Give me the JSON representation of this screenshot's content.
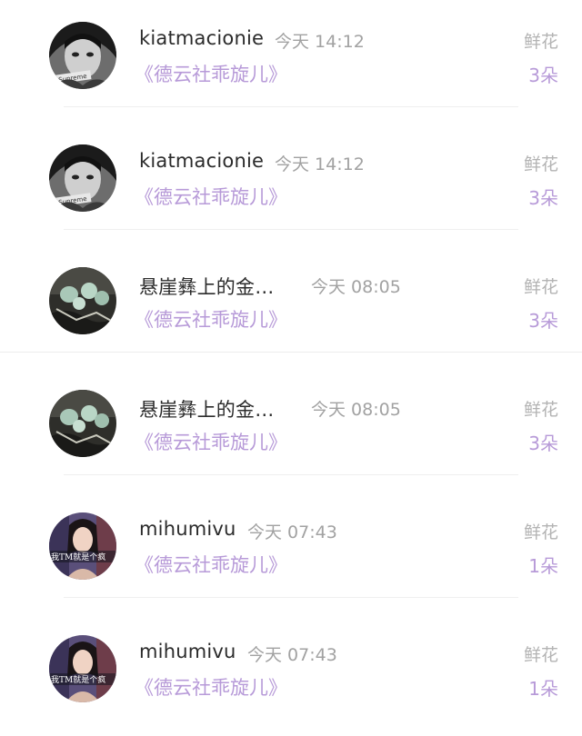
{
  "flower_list": {
    "items": [
      {
        "avatar": "avatar-bw-girl-supreme",
        "name": "kiatmacionie",
        "time": "今天 14:12",
        "gift_name": "《德云社乖旋儿》",
        "gift_label": "鲜花",
        "gift_count": "3朵"
      },
      {
        "avatar": "avatar-bw-girl-supreme",
        "name": "kiatmacionie",
        "time": "今天 14:12",
        "gift_name": "《德云社乖旋儿》",
        "gift_label": "鲜花",
        "gift_count": "3朵"
      },
      {
        "avatar": "avatar-jade-ornaments",
        "name": "悬崖彝上的金…",
        "time": "今天 08:05",
        "gift_name": "《德云社乖旋儿》",
        "gift_label": "鲜花",
        "gift_count": "3朵"
      },
      {
        "avatar": "avatar-jade-ornaments",
        "name": "悬崖彝上的金…",
        "time": "今天 08:05",
        "gift_name": "《德云社乖旋儿》",
        "gift_label": "鲜花",
        "gift_count": "3朵"
      },
      {
        "avatar": "avatar-girl-photo",
        "avatar_text": "我TM就是个疯",
        "name": "mihumivu",
        "time": "今天 07:43",
        "gift_name": "《德云社乖旋儿》",
        "gift_label": "鲜花",
        "gift_count": "1朵"
      },
      {
        "avatar": "avatar-girl-photo",
        "avatar_text": "我TM就是个疯",
        "name": "mihumivu",
        "time": "今天 07:43",
        "gift_name": "《德云社乖旋儿》",
        "gift_label": "鲜花",
        "gift_count": "1朵"
      }
    ]
  },
  "avatar_overlay": {
    "supreme_text": "Supreme"
  },
  "colors": {
    "accent_purple": "#b79ad8",
    "name_text": "#2b2b2b",
    "muted_text": "#a2a2a2"
  }
}
